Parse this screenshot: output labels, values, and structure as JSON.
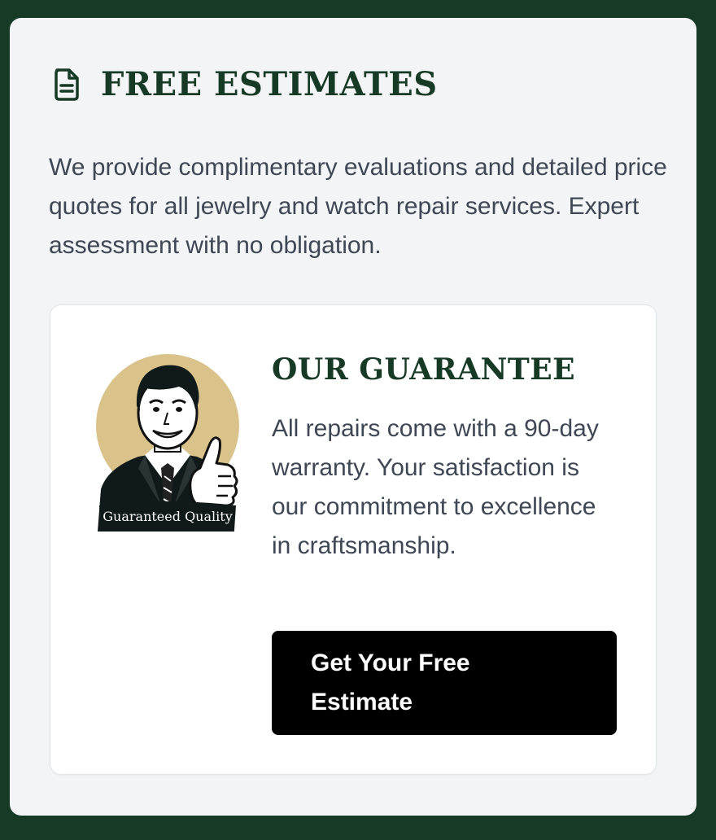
{
  "section": {
    "icon": "document-icon",
    "title": "FREE ESTIMATES",
    "description": "We provide complimentary evaluations and detailed price quotes for all jewelry and watch repair services. Expert assessment with no obligation."
  },
  "guarantee": {
    "illustration": "thumbs-up-man-illustration",
    "badge_text": "Guaranteed Quality",
    "title": "OUR GUARANTEE",
    "text": "All repairs come with a 90-day warranty. Your satisfaction is our commitment to excellence in craftsmanship.",
    "cta_label": "Get Your Free Estimate"
  },
  "colors": {
    "page_background": "#163a25",
    "card_background": "#f2f4f6",
    "heading": "#163a25",
    "body_text": "#3f4754",
    "button": "#000000",
    "illustration_accent": "#d9c38a"
  }
}
